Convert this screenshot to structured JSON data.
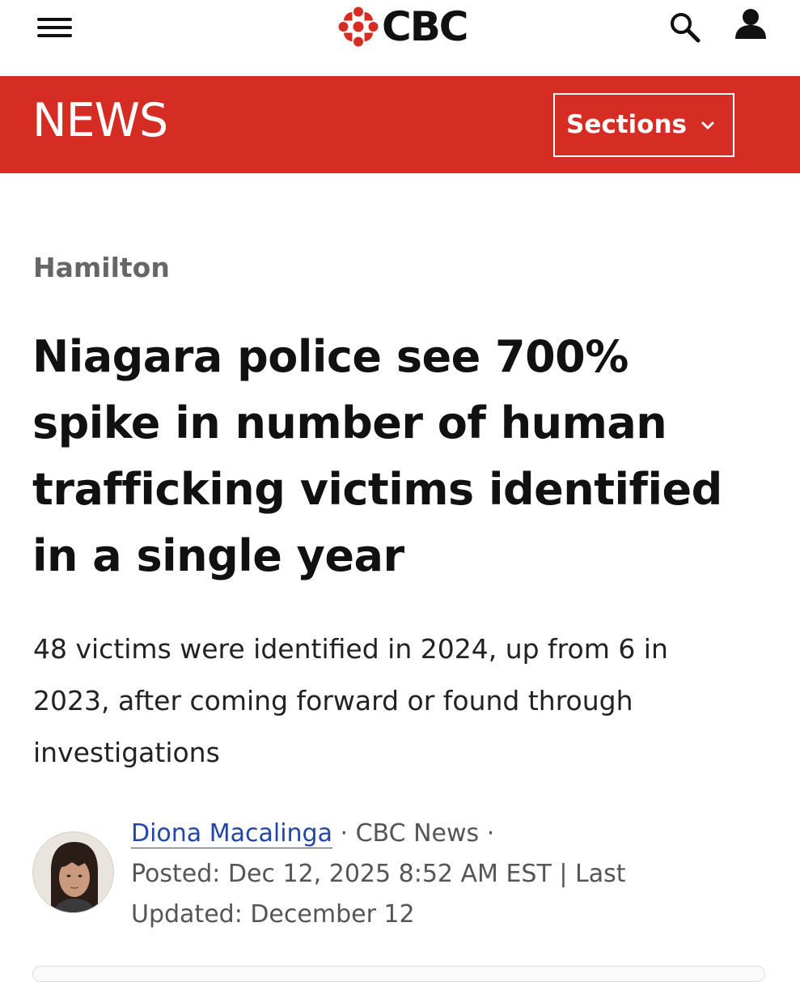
{
  "header": {
    "menu_icon": "hamburger-menu-icon",
    "logo_text": "CBC",
    "logo_icon": "cbc-gem-icon",
    "search_icon": "search-icon",
    "account_icon": "user-icon"
  },
  "newsbar": {
    "label": "NEWS",
    "sections_label": "Sections",
    "sections_icon": "chevron-down-icon",
    "background_color": "#d52c23"
  },
  "article": {
    "category": "Hamilton",
    "headline_lines": [
      "Niagara police see 700%",
      "spike in number of human",
      "trafficking victims identified",
      "in a single year"
    ],
    "deck_lines": [
      "48 victims were identified in 2024, up from 6 in",
      "2023, after coming forward or found through",
      "investigations"
    ]
  },
  "byline": {
    "author": "Diona Macalinga",
    "separator1": " · ",
    "outlet": "CBC News",
    "separator2": " ·",
    "posted_line": "Posted: Dec 12, 2025 8:52 AM EST | Last",
    "updated_line": "Updated: December 12",
    "avatar_icon": "author-avatar",
    "link_color": "#2346a8"
  }
}
